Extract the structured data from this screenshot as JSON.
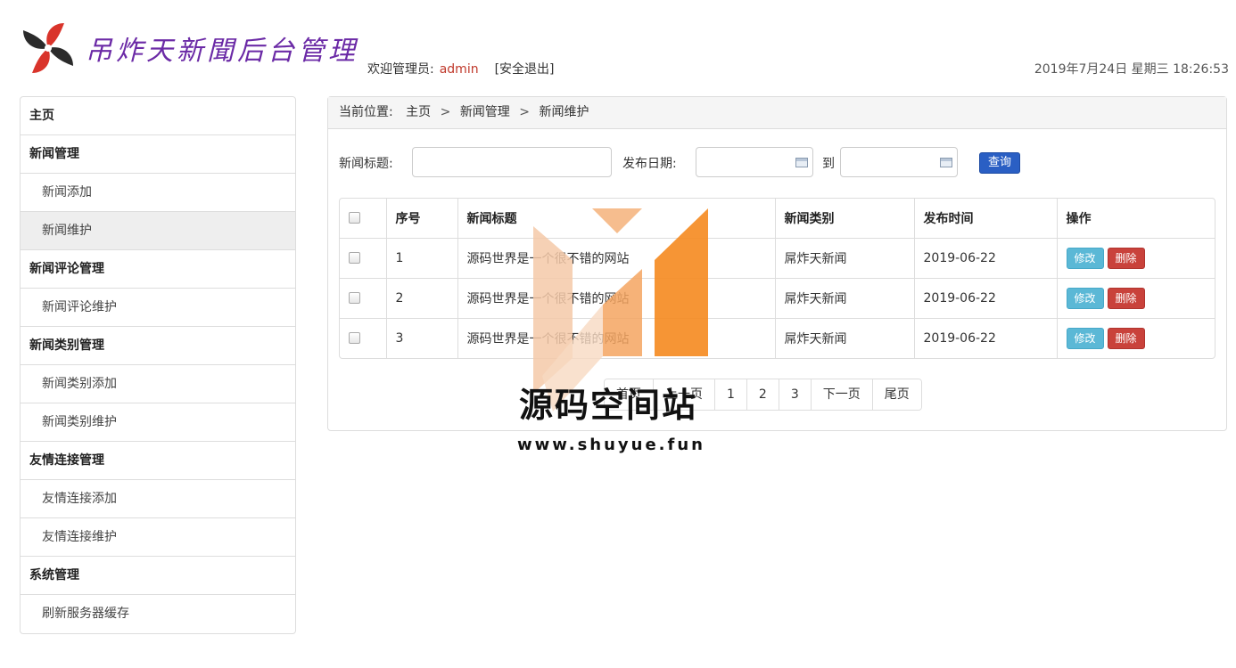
{
  "header": {
    "logo_text": "吊炸天新聞后台管理",
    "welcome_prefix": "欢迎管理员:",
    "admin_name": "admin",
    "logout_label": "[安全退出]",
    "datetime": "2019年7月24日 星期三 18:26:53"
  },
  "sidebar": {
    "items": [
      {
        "label": "主页",
        "type": "group"
      },
      {
        "label": "新闻管理",
        "type": "group"
      },
      {
        "label": "新闻添加",
        "type": "sub"
      },
      {
        "label": "新闻维护",
        "type": "sub",
        "active": true
      },
      {
        "label": "新闻评论管理",
        "type": "group"
      },
      {
        "label": "新闻评论维护",
        "type": "sub"
      },
      {
        "label": "新闻类别管理",
        "type": "group"
      },
      {
        "label": "新闻类别添加",
        "type": "sub"
      },
      {
        "label": "新闻类别维护",
        "type": "sub"
      },
      {
        "label": "友情连接管理",
        "type": "group"
      },
      {
        "label": "友情连接添加",
        "type": "sub"
      },
      {
        "label": "友情连接维护",
        "type": "sub"
      },
      {
        "label": "系统管理",
        "type": "group"
      },
      {
        "label": "刷新服务器缓存",
        "type": "sub"
      }
    ]
  },
  "breadcrumb": {
    "prefix": "当前位置:",
    "items": [
      "主页",
      "新闻管理",
      "新闻维护"
    ],
    "separator": ">"
  },
  "search": {
    "title_label": "新闻标题:",
    "title_value": "",
    "date_label": "发布日期:",
    "date_from_value": "",
    "to_label": "到",
    "date_to_value": "",
    "query_label": "查询"
  },
  "table": {
    "headers": [
      "序号",
      "新闻标题",
      "新闻类别",
      "发布时间",
      "操作"
    ],
    "rows": [
      {
        "id": "1",
        "title": "源码世界是一个很不错的网站",
        "category": "屌炸天新闻",
        "date": "2019-06-22"
      },
      {
        "id": "2",
        "title": "源码世界是一个很不错的网站",
        "category": "屌炸天新闻",
        "date": "2019-06-22"
      },
      {
        "id": "3",
        "title": "源码世界是一个很不错的网站",
        "category": "屌炸天新闻",
        "date": "2019-06-22"
      }
    ],
    "edit_label": "修改",
    "delete_label": "删除"
  },
  "pager": {
    "first": "首页",
    "prev": "上一页",
    "pages": [
      "1",
      "2",
      "3"
    ],
    "next": "下一页",
    "last": "尾页"
  },
  "watermark": {
    "text": "源码空间站",
    "url": "www.shuyue.fun"
  },
  "colors": {
    "logo_purple": "#6b2aa6",
    "admin_red": "#c0392b",
    "query_blue": "#2a5fc4",
    "edit_cyan": "#5bb8d6",
    "delete_red": "#c9423b",
    "watermark_orange": "#f5891f"
  }
}
